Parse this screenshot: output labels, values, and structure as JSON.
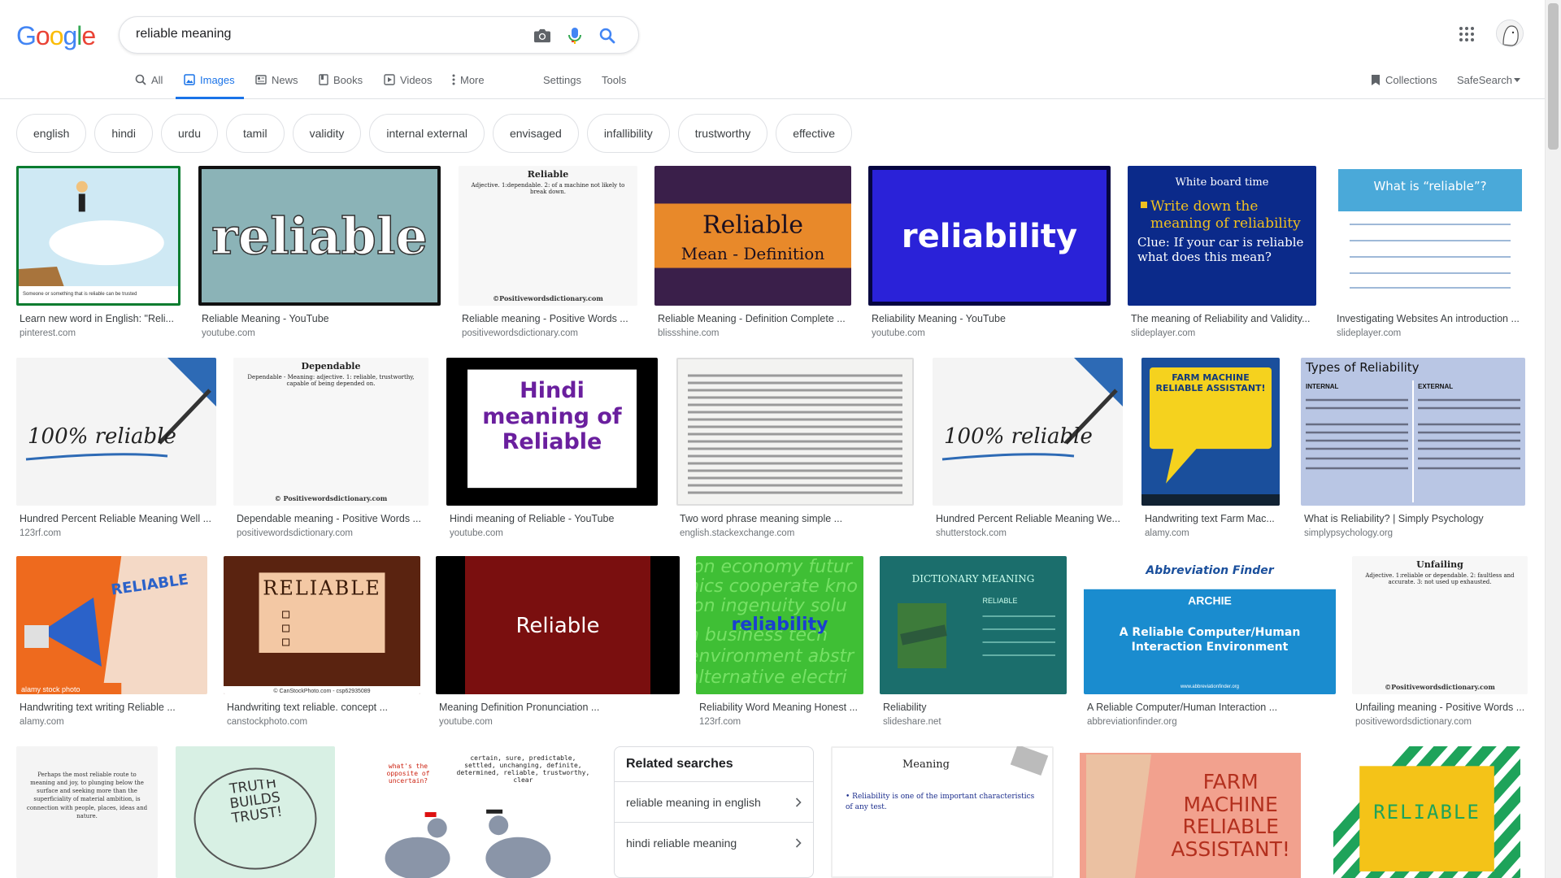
{
  "logo": {
    "letters": [
      "G",
      "o",
      "o",
      "g",
      "l",
      "e"
    ],
    "colors": [
      "#4285F4",
      "#EA4335",
      "#FBBC05",
      "#4285F4",
      "#34A853",
      "#EA4335"
    ]
  },
  "search": {
    "value": "reliable meaning"
  },
  "tabs": [
    {
      "label": "All",
      "icon": "search-icon"
    },
    {
      "label": "Images",
      "icon": "image-icon",
      "active": true
    },
    {
      "label": "News",
      "icon": "news-icon"
    },
    {
      "label": "Books",
      "icon": "book-icon"
    },
    {
      "label": "Videos",
      "icon": "video-icon"
    },
    {
      "label": "More",
      "icon": "more-vert-icon"
    }
  ],
  "tools": {
    "settings": "Settings",
    "tools": "Tools",
    "collections": "Collections",
    "safesearch": "SafeSearch"
  },
  "chips": [
    "english",
    "hindi",
    "urdu",
    "tamil",
    "validity",
    "internal external",
    "envisaged",
    "infallibility",
    "trustworthy",
    "effective"
  ],
  "results": {
    "row1": [
      {
        "title": "Learn new word in English: \"Reli...",
        "source": "pinterest.com",
        "img": "cartoon-cliff",
        "bg": "#cfe9f4"
      },
      {
        "title": "Reliable Meaning - YouTube",
        "source": "youtube.com",
        "img": "text-reliable",
        "bg": "#8bb3b7",
        "text": "reliable"
      },
      {
        "title": "Reliable meaning - Positive Words ...",
        "source": "positivewordsdictionary.com",
        "img": "dict-page",
        "bg": "#f7f7f7",
        "text": "Reliable",
        "sub": "Adjective. 1:dependable. 2: of a machine not likely to break down.",
        "footer": "©Positivewordsdictionary.com"
      },
      {
        "title": "Reliable Meaning - Definition Complete ...",
        "source": "blissshine.com",
        "img": "orange-band",
        "bg": "#3a1f4a",
        "text": "Reliable",
        "sub": "Mean - Definition"
      },
      {
        "title": "Reliability Meaning - YouTube",
        "source": "youtube.com",
        "img": "blue-text",
        "bg": "#2a22d8",
        "text": "reliability"
      },
      {
        "title": "The meaning of Reliability and Validity...",
        "source": "slideplayer.com",
        "img": "whiteboard",
        "bg": "#0b2a8a",
        "text": "White board time",
        "sub": "Write down the meaning of reliability",
        "sub2": "Clue: If your car is reliable what does this mean?"
      },
      {
        "title": "Investigating Websites An introduction ...",
        "source": "slideplayer.com",
        "img": "what-is",
        "bg": "#ffffff",
        "text": "What is “reliable”?"
      }
    ],
    "row2": [
      {
        "title": "Hundred Percent Reliable Meaning Well ...",
        "source": "123rf.com",
        "img": "hundred-percent",
        "bg": "#f4f4f4",
        "text": "100% reliable"
      },
      {
        "title": "Dependable meaning - Positive Words ...",
        "source": "positivewordsdictionary.com",
        "img": "dict-page",
        "bg": "#f7f7f7",
        "text": "Dependable",
        "sub": "Dependable - Meaning: adjective. 1: reliable, trustworthy, capable of being depended on.",
        "footer": "© Positivewordsdictionary.com"
      },
      {
        "title": "Hindi meaning of Reliable - YouTube",
        "source": "youtube.com",
        "img": "hindi",
        "bg": "#000000",
        "text": "Hindi meaning of Reliable"
      },
      {
        "title": "Two word phrase meaning simple ...",
        "source": "english.stackexchange.com",
        "img": "book-page",
        "bg": "#f3f3f1"
      },
      {
        "title": "Hundred Percent Reliable Meaning We...",
        "source": "shutterstock.com",
        "img": "hundred-percent",
        "bg": "#f4f4f4",
        "text": "100% reliable"
      },
      {
        "title": "Handwriting text Farm Mac...",
        "source": "alamy.com",
        "img": "farm-bubble",
        "bg": "#1a4f9c",
        "text": "FARM MACHINE RELIABLE ASSISTANT!"
      },
      {
        "title": "What is Reliability? | Simply Psychology",
        "source": "simplypsychology.org",
        "img": "types",
        "bg": "#b9c6e4",
        "text": "Types of Reliability",
        "left_head": "INTERNAL",
        "right_head": "EXTERNAL"
      }
    ],
    "row3": [
      {
        "title": "Handwriting text writing Reliable ...",
        "source": "alamy.com",
        "img": "megaphone",
        "bg": "#ee6a1e",
        "text": "RELIABLE",
        "wm": "alamy stock photo"
      },
      {
        "title": "Handwriting text reliable. concept ...",
        "source": "canstockphoto.com",
        "img": "sign",
        "bg": "#5a2310",
        "text": "RELIABLE",
        "wm": "© CanStockPhoto.com - csp62935089"
      },
      {
        "title": "Meaning Definition Pronunciation ...",
        "source": "youtube.com",
        "img": "dark-red",
        "bg": "#7a0f0f",
        "text": "Reliable"
      },
      {
        "title": "Reliability Word Meaning Honest ...",
        "source": "123rf.com",
        "img": "green-words",
        "bg": "#3fbf35",
        "text": "reliability"
      },
      {
        "title": "Reliability",
        "source": "slideshare.net",
        "img": "dictionary-meaning",
        "bg": "#1b6e6c",
        "text": "DICTIONARY MEANING",
        "sub": "RELIABLE"
      },
      {
        "title": "A Reliable Computer/Human Interaction ...",
        "source": "abbreviationfinder.org",
        "img": "abbrev",
        "bg": "#1a8ccf",
        "text": "Abbreviation Finder",
        "sub": "ARCHIE",
        "sub2": "A Reliable Computer/Human Interaction Environment",
        "footer": "www.abbreviationfinder.org"
      },
      {
        "title": "Unfailing meaning - Positive Words ...",
        "source": "positivewordsdictionary.com",
        "img": "dict-page",
        "bg": "#f7f7f7",
        "text": "Unfailing",
        "sub": "Adjective. 1:reliable or dependable. 2: faultless and accurate. 3: not used up exhausted.",
        "footer": "©Positivewordsdictionary.com"
      }
    ],
    "row4": [
      {
        "img": "quote",
        "bg": "#f4f4f4",
        "text": "Perhaps the most reliable route to meaning and joy, to plunging below the surface and seeking more than the superficiality of material ambition, is connection with people, places, ideas and nature."
      },
      {
        "img": "truth",
        "bg": "#d8f0e4",
        "text": "TRUTH BUILDS TRUST!"
      },
      {
        "img": "pigeons",
        "bg": "#ffffff",
        "text": "what's the opposite of uncertain?",
        "sub": "certain, sure, predictable, settled, unchanging, definite, determined, reliable, trustworthy, clear"
      },
      {
        "img": "meaning-slide",
        "bg": "#ffffff",
        "text": "Meaning",
        "sub": "Reliability is one of the important characteristics of any test."
      },
      {
        "img": "farm-pink",
        "bg": "#f2a18e",
        "text": "FARM MACHINE RELIABLE ASSISTANT!"
      },
      {
        "img": "stripes",
        "bg": "#1ea35a",
        "text": "RELIABLE"
      }
    ]
  },
  "related": {
    "title": "Related searches",
    "items": [
      "reliable meaning in english",
      "hindi reliable meaning"
    ]
  }
}
